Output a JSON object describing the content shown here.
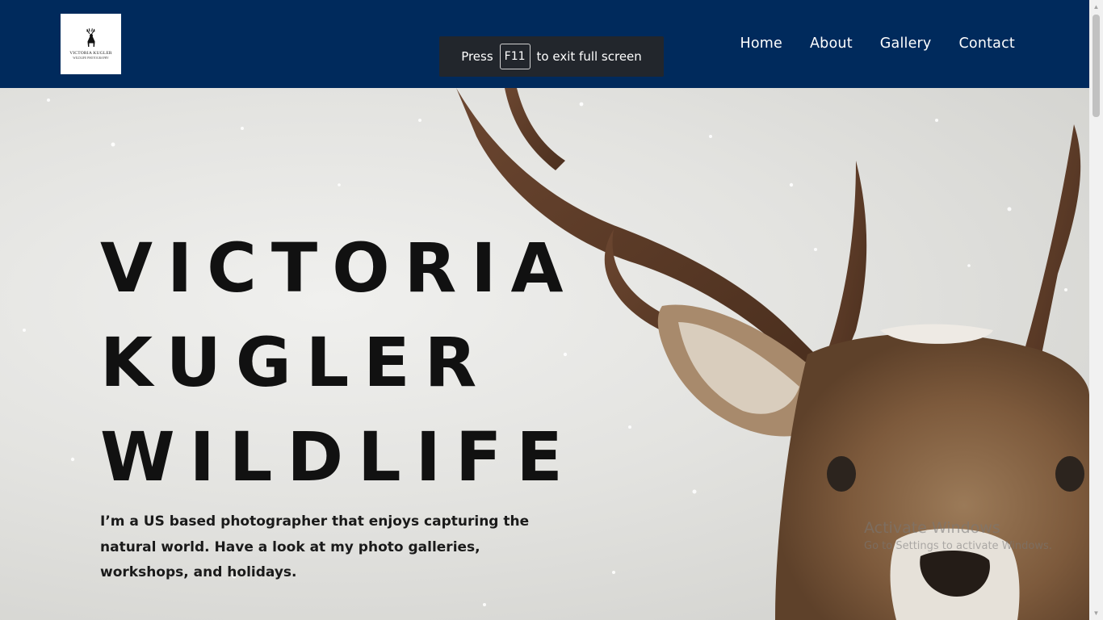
{
  "logo": {
    "name": "VICTORIA KUGLER",
    "subtitle": "WILDLIFE PHOTOGRAPHY",
    "icon": "deer-icon"
  },
  "nav": {
    "items": [
      "Home",
      "About",
      "Gallery",
      "Contact"
    ]
  },
  "fullscreen_notice": {
    "before": "Press",
    "key": "F11",
    "after": "to exit full screen"
  },
  "hero": {
    "title_lines": [
      "VICTORIA",
      "KUGLER",
      "WILDLIFE"
    ],
    "text": "I’m a US based photographer that enjoys capturing the natural world. Have a look at my photo galleries, workshops, and holidays."
  },
  "watermark": {
    "line1": "Activate Windows",
    "line2": "Go to Settings to activate Windows."
  },
  "colors": {
    "header_bg": "#002a5c",
    "nav_text": "#ffffff",
    "title_text": "#111111"
  }
}
